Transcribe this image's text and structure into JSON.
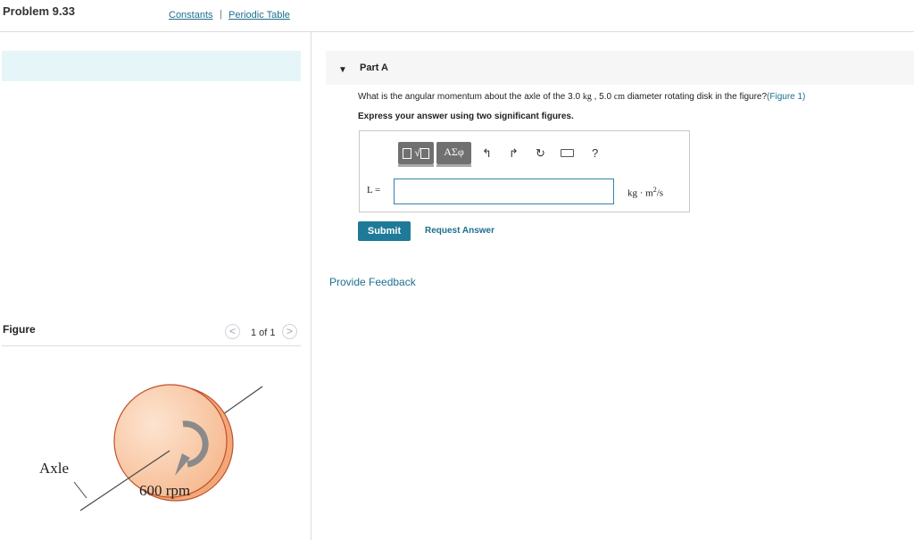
{
  "problem": {
    "title": "Problem 9.33"
  },
  "resources": {
    "constants": "Constants",
    "separator": "|",
    "periodic_table": "Periodic Table"
  },
  "figure": {
    "label": "Figure",
    "page": "1 of 1",
    "prev_glyph": "<",
    "next_glyph": ">",
    "axle_label": "Axle",
    "rpm_label": "600 rpm"
  },
  "part": {
    "title": "Part A",
    "question_pre": "What is the angular momentum about the axle of the 3.0 ",
    "mass_unit": "kg",
    "question_mid": " , 5.0 ",
    "length_unit": "cm",
    "question_post": " diameter rotating disk in the figure?",
    "figure_ref": "(Figure 1)",
    "instruction": "Express your answer using two significant figures."
  },
  "toolbar": {
    "templates_label": "√",
    "symbols_label": "ΑΣφ",
    "undo": "↰",
    "redo": "↱",
    "reset": "↻",
    "help": "?"
  },
  "answer": {
    "label": "L =",
    "value": "",
    "unit_base": "kg · m",
    "unit_exp": "2",
    "unit_tail": "/s"
  },
  "actions": {
    "submit": "Submit",
    "request_answer": "Request Answer",
    "provide_feedback": "Provide Feedback"
  },
  "colors": {
    "link": "#1e6f8e",
    "submit": "#1e7a98",
    "disk_face": "#f9c9a6",
    "disk_edge": "#c0502a"
  }
}
